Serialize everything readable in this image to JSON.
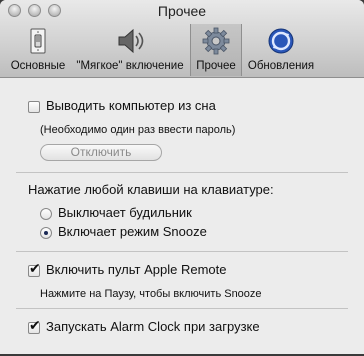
{
  "window": {
    "title": "Прочее"
  },
  "toolbar": {
    "tabs": [
      {
        "label": "Основные",
        "icon": "light-switch-icon"
      },
      {
        "label": "\"Мягкое\" включение",
        "icon": "speaker-icon"
      },
      {
        "label": "Прочее",
        "icon": "gear-icon",
        "selected": true
      },
      {
        "label": "Обновления",
        "icon": "sync-update-icon"
      }
    ]
  },
  "wake": {
    "checkbox_label": "Выводить компьютер из сна",
    "checked": false,
    "note": "(Необходимо один раз ввести пароль)",
    "button_label": "Отключить"
  },
  "keypress": {
    "heading": "Нажатие любой клавиши на клавиатуре:",
    "options": [
      {
        "label": "Выключает будильник",
        "selected": false
      },
      {
        "label": "Включает режим Snooze",
        "selected": true
      }
    ]
  },
  "remote": {
    "checkbox_label": "Включить пульт Apple Remote",
    "checked": true,
    "note": "Нажмите на Паузу, чтобы включить Snooze"
  },
  "startup": {
    "checkbox_label": "Запускать Alarm Clock при загрузке",
    "checked": true
  },
  "colors": {
    "accent": "#1b2a55",
    "window_bg": "#ececec",
    "disabled_text": "#8a8a8a"
  }
}
